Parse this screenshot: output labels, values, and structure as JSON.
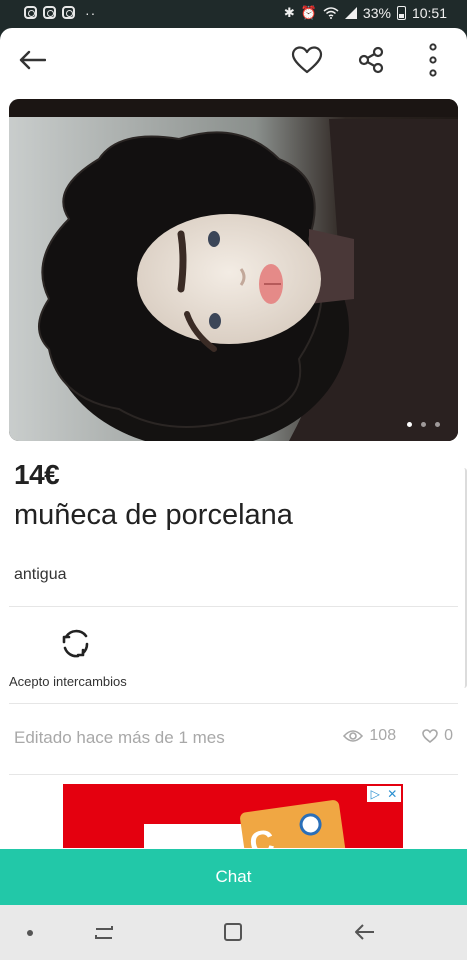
{
  "status_bar": {
    "battery": "33%",
    "time": "10:51",
    "icons": [
      "instagram-icon",
      "instagram-icon",
      "instagram-icon",
      "more-dots-icon",
      "bluetooth-icon",
      "alarm-icon",
      "wifi-icon",
      "signal-icon",
      "battery-icon"
    ]
  },
  "header": {
    "icons": [
      "back-arrow-icon",
      "heart-icon",
      "share-icon",
      "more-vertical-icon"
    ]
  },
  "listing": {
    "price": "14€",
    "title": "muñeca de porcelana",
    "description": "antigua",
    "exchange_label": "Acepto intercambios",
    "edited": "Editado hace más de 1 mes",
    "views": "108",
    "favorites": "0",
    "photo_count": 3,
    "photo_current": 1
  },
  "ad": {
    "choices_icons": [
      "play-icon",
      "close-icon"
    ],
    "brand_color": "#e4000f"
  },
  "chat_button": {
    "label": "Chat",
    "color": "#22c8a8"
  },
  "nav_bar": {
    "icons": [
      "dot-icon",
      "recents-icon",
      "home-icon",
      "back-icon"
    ]
  }
}
